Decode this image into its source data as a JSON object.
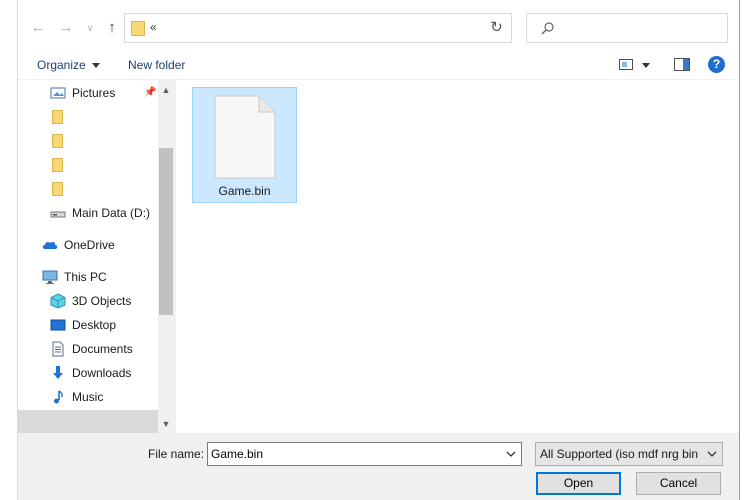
{
  "address": {
    "breadcrumb": "«",
    "search_placeholder": ""
  },
  "toolbar": {
    "organize_label": "Organize",
    "new_folder_label": "New folder"
  },
  "nav": {
    "items": [
      {
        "label": "Pictures",
        "icon": "pictures-icon"
      },
      {
        "label": "",
        "icon": "folder-icon"
      },
      {
        "label": "",
        "icon": "folder-icon"
      },
      {
        "label": "",
        "icon": "folder-icon"
      },
      {
        "label": "",
        "icon": "folder-icon"
      },
      {
        "label": "Main Data (D:)",
        "icon": "drive-icon"
      },
      {
        "label": "OneDrive",
        "icon": "onedrive-icon"
      },
      {
        "label": "This PC",
        "icon": "this-pc-icon"
      },
      {
        "label": "3D Objects",
        "icon": "3d-objects-icon"
      },
      {
        "label": "Desktop",
        "icon": "desktop-icon"
      },
      {
        "label": "Documents",
        "icon": "documents-icon"
      },
      {
        "label": "Downloads",
        "icon": "downloads-icon"
      },
      {
        "label": "Music",
        "icon": "music-icon"
      }
    ]
  },
  "files": [
    {
      "name": "Game.bin",
      "selected": true
    }
  ],
  "bottom": {
    "file_name_label": "File name:",
    "file_name_value": "Game.bin",
    "filter_value": "All Supported (iso mdf nrg bin",
    "open_label": "Open",
    "cancel_label": "Cancel"
  },
  "colors": {
    "selection_bg": "#cce8ff",
    "selection_border": "#99d1ff",
    "accent": "#0078d7",
    "folder": "#f8d775"
  }
}
